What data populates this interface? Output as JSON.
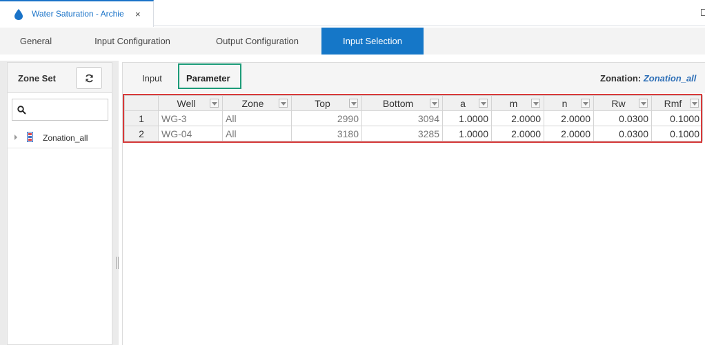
{
  "doc_tab": {
    "title": "Water Saturation - Archie",
    "close": "×"
  },
  "section_tabs": [
    "General",
    "Input Configuration",
    "Output Configuration",
    "Input Selection"
  ],
  "left_panel": {
    "title": "Zone Set",
    "search": {
      "value": "",
      "placeholder": ""
    },
    "tree": [
      {
        "label": "Zonation_all"
      }
    ]
  },
  "right_panel": {
    "subtabs": [
      "Input",
      "Parameter"
    ],
    "zonation": {
      "label": "Zonation:",
      "value": "Zonation_all"
    },
    "grid": {
      "columns": [
        "Well",
        "Zone",
        "Top",
        "Bottom",
        "a",
        "m",
        "n",
        "Rw",
        "Rmf"
      ],
      "rows": [
        {
          "num": "1",
          "well": "WG-3",
          "zone": "All",
          "top": "2990",
          "bottom": "3094",
          "a": "1.0000",
          "m": "2.0000",
          "n": "2.0000",
          "rw": "0.0300",
          "rmf": "0.1000"
        },
        {
          "num": "2",
          "well": "WG-04",
          "zone": "All",
          "top": "3180",
          "bottom": "3285",
          "a": "1.0000",
          "m": "2.0000",
          "n": "2.0000",
          "rw": "0.0300",
          "rmf": "0.1000"
        }
      ]
    }
  },
  "colors": {
    "accent": "#1577c8",
    "highlight_green": "#1c9b78",
    "highlight_red": "#d83a3a",
    "link": "#2e6fb7"
  }
}
